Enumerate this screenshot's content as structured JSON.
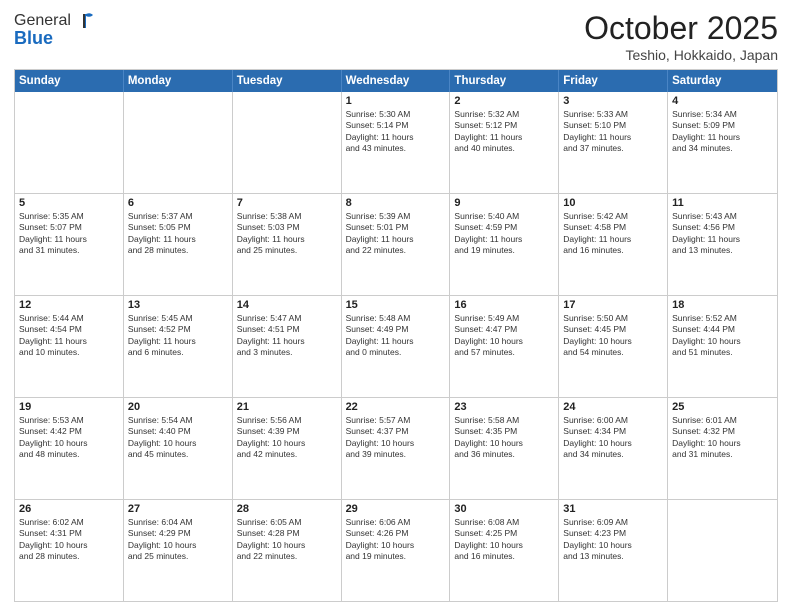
{
  "header": {
    "logo_general": "General",
    "logo_blue": "Blue",
    "month": "October 2025",
    "location": "Teshio, Hokkaido, Japan"
  },
  "days_of_week": [
    "Sunday",
    "Monday",
    "Tuesday",
    "Wednesday",
    "Thursday",
    "Friday",
    "Saturday"
  ],
  "weeks": [
    [
      {
        "day": "",
        "text": ""
      },
      {
        "day": "",
        "text": ""
      },
      {
        "day": "",
        "text": ""
      },
      {
        "day": "1",
        "text": "Sunrise: 5:30 AM\nSunset: 5:14 PM\nDaylight: 11 hours\nand 43 minutes."
      },
      {
        "day": "2",
        "text": "Sunrise: 5:32 AM\nSunset: 5:12 PM\nDaylight: 11 hours\nand 40 minutes."
      },
      {
        "day": "3",
        "text": "Sunrise: 5:33 AM\nSunset: 5:10 PM\nDaylight: 11 hours\nand 37 minutes."
      },
      {
        "day": "4",
        "text": "Sunrise: 5:34 AM\nSunset: 5:09 PM\nDaylight: 11 hours\nand 34 minutes."
      }
    ],
    [
      {
        "day": "5",
        "text": "Sunrise: 5:35 AM\nSunset: 5:07 PM\nDaylight: 11 hours\nand 31 minutes."
      },
      {
        "day": "6",
        "text": "Sunrise: 5:37 AM\nSunset: 5:05 PM\nDaylight: 11 hours\nand 28 minutes."
      },
      {
        "day": "7",
        "text": "Sunrise: 5:38 AM\nSunset: 5:03 PM\nDaylight: 11 hours\nand 25 minutes."
      },
      {
        "day": "8",
        "text": "Sunrise: 5:39 AM\nSunset: 5:01 PM\nDaylight: 11 hours\nand 22 minutes."
      },
      {
        "day": "9",
        "text": "Sunrise: 5:40 AM\nSunset: 4:59 PM\nDaylight: 11 hours\nand 19 minutes."
      },
      {
        "day": "10",
        "text": "Sunrise: 5:42 AM\nSunset: 4:58 PM\nDaylight: 11 hours\nand 16 minutes."
      },
      {
        "day": "11",
        "text": "Sunrise: 5:43 AM\nSunset: 4:56 PM\nDaylight: 11 hours\nand 13 minutes."
      }
    ],
    [
      {
        "day": "12",
        "text": "Sunrise: 5:44 AM\nSunset: 4:54 PM\nDaylight: 11 hours\nand 10 minutes."
      },
      {
        "day": "13",
        "text": "Sunrise: 5:45 AM\nSunset: 4:52 PM\nDaylight: 11 hours\nand 6 minutes."
      },
      {
        "day": "14",
        "text": "Sunrise: 5:47 AM\nSunset: 4:51 PM\nDaylight: 11 hours\nand 3 minutes."
      },
      {
        "day": "15",
        "text": "Sunrise: 5:48 AM\nSunset: 4:49 PM\nDaylight: 11 hours\nand 0 minutes."
      },
      {
        "day": "16",
        "text": "Sunrise: 5:49 AM\nSunset: 4:47 PM\nDaylight: 10 hours\nand 57 minutes."
      },
      {
        "day": "17",
        "text": "Sunrise: 5:50 AM\nSunset: 4:45 PM\nDaylight: 10 hours\nand 54 minutes."
      },
      {
        "day": "18",
        "text": "Sunrise: 5:52 AM\nSunset: 4:44 PM\nDaylight: 10 hours\nand 51 minutes."
      }
    ],
    [
      {
        "day": "19",
        "text": "Sunrise: 5:53 AM\nSunset: 4:42 PM\nDaylight: 10 hours\nand 48 minutes."
      },
      {
        "day": "20",
        "text": "Sunrise: 5:54 AM\nSunset: 4:40 PM\nDaylight: 10 hours\nand 45 minutes."
      },
      {
        "day": "21",
        "text": "Sunrise: 5:56 AM\nSunset: 4:39 PM\nDaylight: 10 hours\nand 42 minutes."
      },
      {
        "day": "22",
        "text": "Sunrise: 5:57 AM\nSunset: 4:37 PM\nDaylight: 10 hours\nand 39 minutes."
      },
      {
        "day": "23",
        "text": "Sunrise: 5:58 AM\nSunset: 4:35 PM\nDaylight: 10 hours\nand 36 minutes."
      },
      {
        "day": "24",
        "text": "Sunrise: 6:00 AM\nSunset: 4:34 PM\nDaylight: 10 hours\nand 34 minutes."
      },
      {
        "day": "25",
        "text": "Sunrise: 6:01 AM\nSunset: 4:32 PM\nDaylight: 10 hours\nand 31 minutes."
      }
    ],
    [
      {
        "day": "26",
        "text": "Sunrise: 6:02 AM\nSunset: 4:31 PM\nDaylight: 10 hours\nand 28 minutes."
      },
      {
        "day": "27",
        "text": "Sunrise: 6:04 AM\nSunset: 4:29 PM\nDaylight: 10 hours\nand 25 minutes."
      },
      {
        "day": "28",
        "text": "Sunrise: 6:05 AM\nSunset: 4:28 PM\nDaylight: 10 hours\nand 22 minutes."
      },
      {
        "day": "29",
        "text": "Sunrise: 6:06 AM\nSunset: 4:26 PM\nDaylight: 10 hours\nand 19 minutes."
      },
      {
        "day": "30",
        "text": "Sunrise: 6:08 AM\nSunset: 4:25 PM\nDaylight: 10 hours\nand 16 minutes."
      },
      {
        "day": "31",
        "text": "Sunrise: 6:09 AM\nSunset: 4:23 PM\nDaylight: 10 hours\nand 13 minutes."
      },
      {
        "day": "",
        "text": ""
      }
    ]
  ]
}
